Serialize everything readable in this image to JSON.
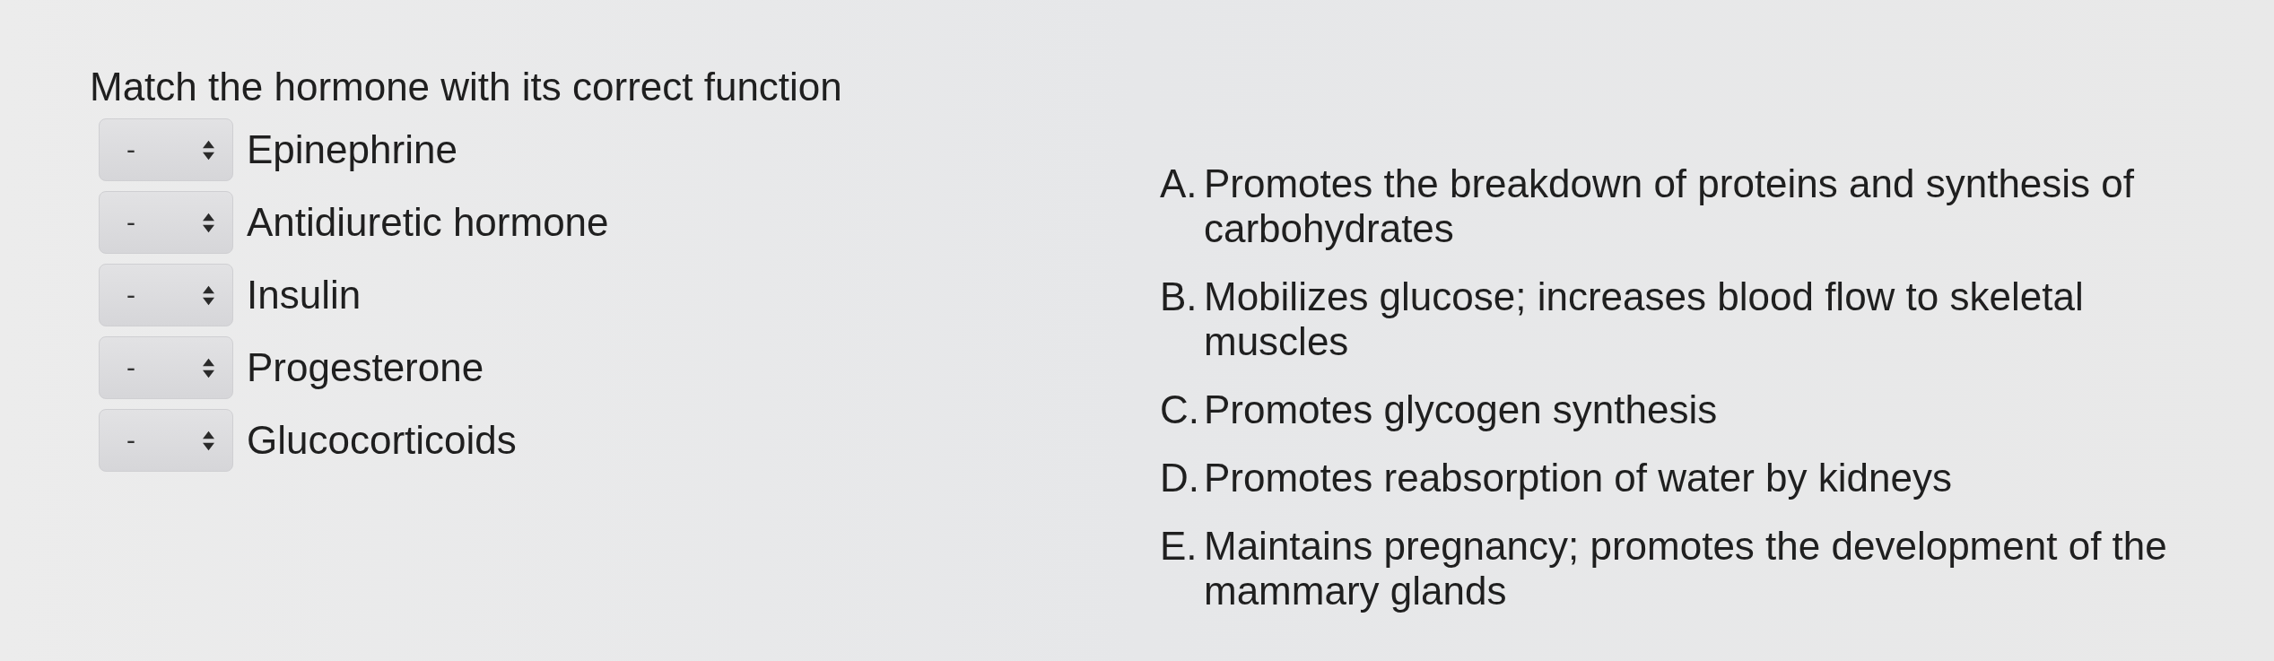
{
  "question": {
    "title": "Match the hormone with its correct function"
  },
  "items": [
    {
      "selection": "-",
      "label": "Epinephrine"
    },
    {
      "selection": "-",
      "label": "Antidiuretic hormone"
    },
    {
      "selection": "-",
      "label": "Insulin"
    },
    {
      "selection": "-",
      "label": "Progesterone"
    },
    {
      "selection": "-",
      "label": "Glucocorticoids"
    }
  ],
  "options": [
    {
      "letter": "A.",
      "text": "Promotes the breakdown of proteins and synthesis of carbohydrates"
    },
    {
      "letter": "B.",
      "text": "Mobilizes glucose; increases blood flow to skeletal muscles"
    },
    {
      "letter": "C.",
      "text": "Promotes glycogen synthesis"
    },
    {
      "letter": "D.",
      "text": "Promotes reabsorption of water by kidneys"
    },
    {
      "letter": "E.",
      "text": "Maintains pregnancy; promotes the development of the mammary glands"
    }
  ]
}
